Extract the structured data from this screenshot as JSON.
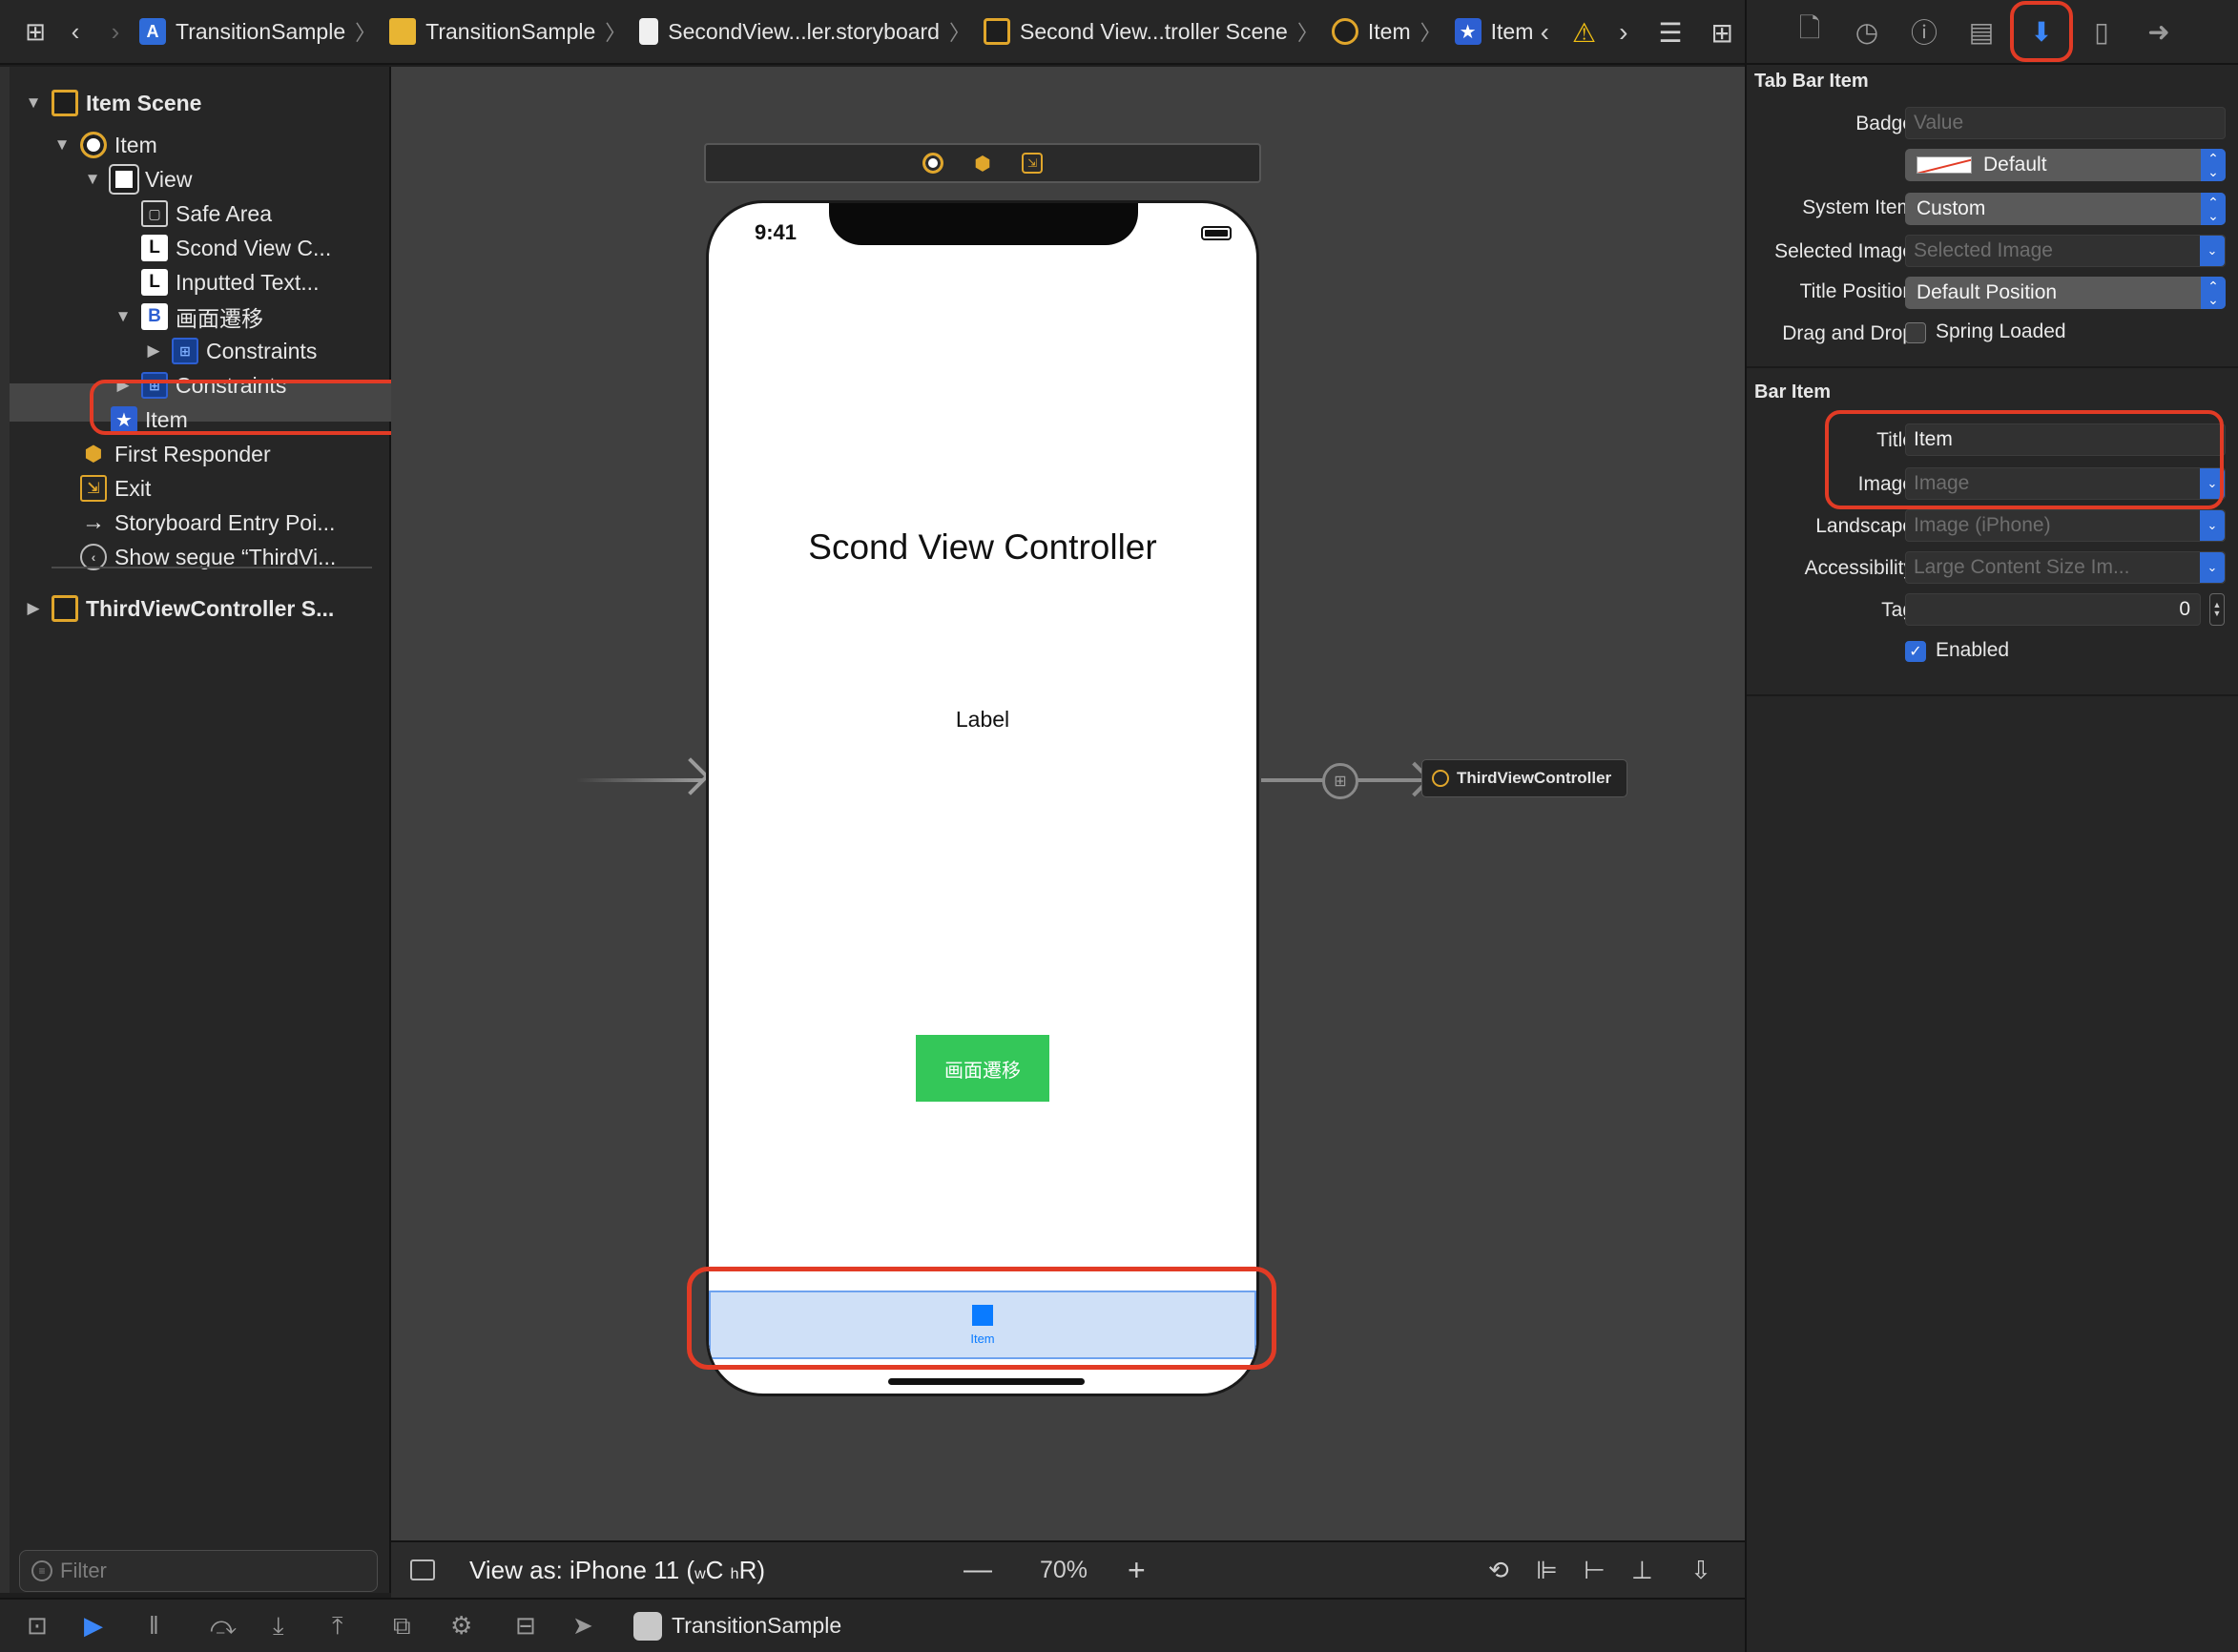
{
  "jumpbar": {
    "crumbs": [
      "TransitionSample",
      "TransitionSample",
      "SecondView...ler.storyboard",
      "Second View...troller Scene",
      "Item",
      "Item"
    ]
  },
  "navigator": {
    "rows": [
      {
        "label": "Item Scene"
      },
      {
        "label": "Item"
      },
      {
        "label": "View"
      },
      {
        "label": "Safe Area"
      },
      {
        "label": "Scond View C..."
      },
      {
        "label": "Inputted Text..."
      },
      {
        "label": "画面遷移"
      },
      {
        "label": "Constraints"
      },
      {
        "label": "Constraints"
      },
      {
        "label": "Item"
      },
      {
        "label": "First Responder"
      },
      {
        "label": "Exit"
      },
      {
        "label": "Storyboard Entry Poi..."
      },
      {
        "label": "Show segue “ThirdVi..."
      },
      {
        "label": "ThirdViewController S..."
      }
    ],
    "icon_letters": {
      "label": "L",
      "button": "B"
    },
    "filter_placeholder": "Filter"
  },
  "canvas": {
    "phone": {
      "time": "9:41",
      "title_label": "Scond View Controller",
      "label": "Label",
      "button": "画面遷移",
      "tab_item": "Item"
    },
    "third_vc": "ThirdViewController",
    "view_as": "View as: iPhone 11 (",
    "view_as_w": "w",
    "view_as_c": "C",
    "view_as_h": "h",
    "view_as_r": "R)",
    "zoom": "70%"
  },
  "debugbar": {
    "target": "TransitionSample"
  },
  "inspector": {
    "tab_bar_item": {
      "title": "Tab Bar Item",
      "badge_label": "Badge",
      "badge_placeholder": "Value",
      "badge_color": "Default",
      "system_item_label": "System Item",
      "system_item": "Custom",
      "selected_image_label": "Selected Image",
      "selected_image_placeholder": "Selected Image",
      "title_position_label": "Title Position",
      "title_position": "Default Position",
      "drag_drop_label": "Drag and Drop",
      "spring_loaded": "Spring Loaded"
    },
    "bar_item": {
      "title": "Bar Item",
      "title_label": "Title",
      "title_value": "Item",
      "image_label": "Image",
      "image_placeholder": "Image",
      "landscape_label": "Landscape",
      "landscape_placeholder": "Image (iPhone)",
      "accessibility_label": "Accessibility",
      "accessibility_placeholder": "Large Content Size Im...",
      "tag_label": "Tag",
      "tag_value": "0",
      "enabled": "Enabled"
    }
  },
  "colors": {
    "accent": "#2f6bd8",
    "highlight": "#e23b25",
    "button_green": "#34c759"
  }
}
